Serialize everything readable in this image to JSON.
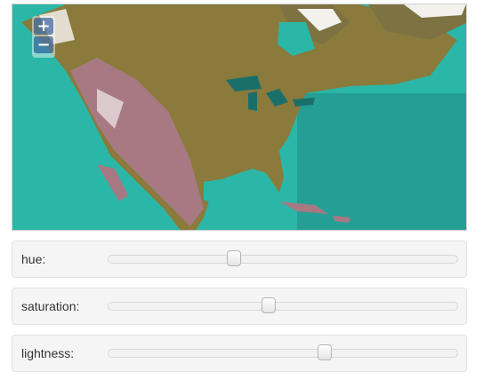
{
  "map": {
    "zoom_in_label": "+",
    "zoom_out_label": "−",
    "colors": {
      "ocean": "#2bb7a7",
      "deep_ocean": "#22908a",
      "land": "#8a7a3c",
      "mountains": "#a77982",
      "snow": "#ffffff"
    }
  },
  "controls": [
    {
      "label": "hue:",
      "value_fraction": 0.36
    },
    {
      "label": "saturation:",
      "value_fraction": 0.46
    },
    {
      "label": "lightness:",
      "value_fraction": 0.62
    }
  ]
}
